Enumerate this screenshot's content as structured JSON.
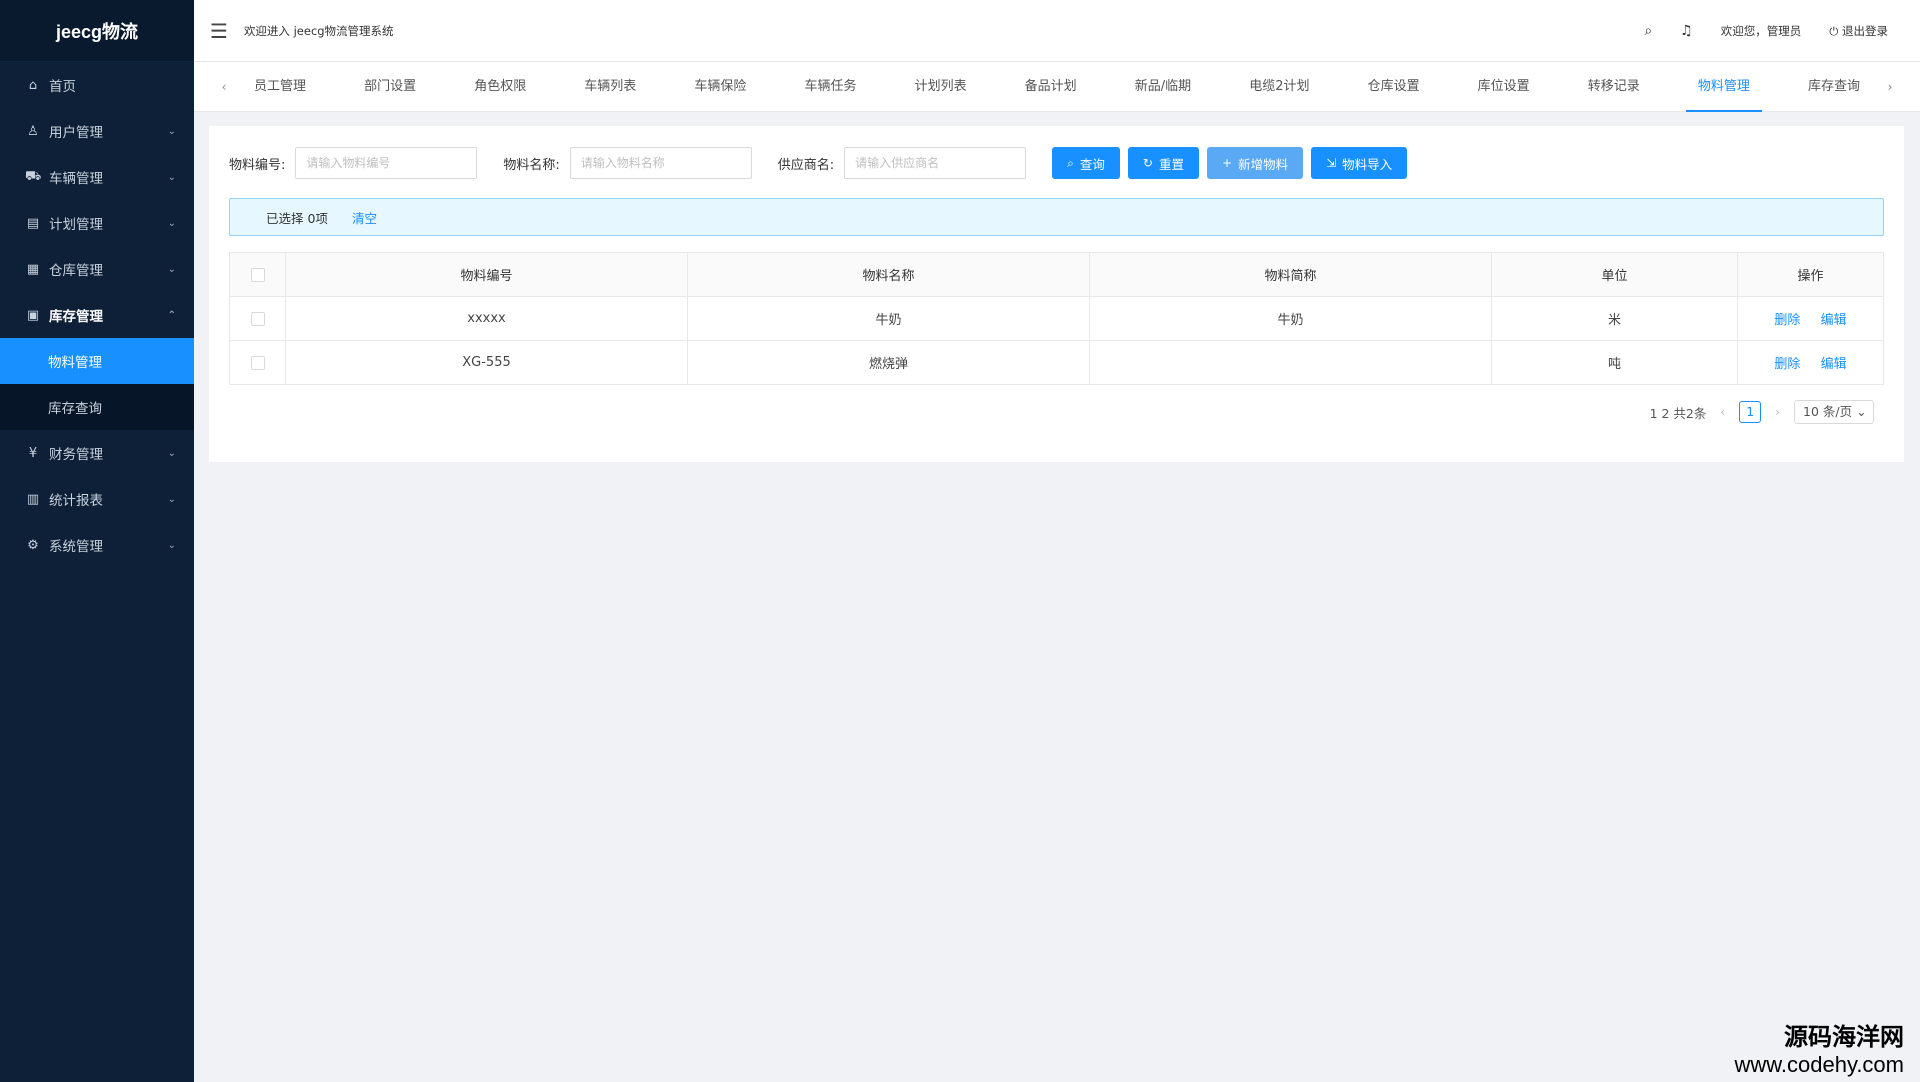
{
  "app": {
    "logo": "jeecg物流",
    "welcome": "欢迎进入 jeecg物流管理系统"
  },
  "header": {
    "greeting": "欢迎您，管理员",
    "logout": "退出登录"
  },
  "sidebar": {
    "items": [
      {
        "label": "首页",
        "icon": "⌂"
      },
      {
        "label": "用户管理",
        "icon": "♙"
      },
      {
        "label": "车辆管理",
        "icon": "⛟"
      },
      {
        "label": "计划管理",
        "icon": "▤"
      },
      {
        "label": "仓库管理",
        "icon": "▦"
      },
      {
        "label": "库存管理",
        "icon": "▣"
      },
      {
        "label": "财务管理",
        "icon": "¥"
      },
      {
        "label": "统计报表",
        "icon": "▥"
      },
      {
        "label": "系统管理",
        "icon": "⚙"
      }
    ],
    "submenu": [
      {
        "label": "物料管理"
      },
      {
        "label": "库存查询"
      }
    ]
  },
  "tabs": [
    "员工管理",
    "部门设置",
    "角色权限",
    "车辆列表",
    "车辆保险",
    "车辆任务",
    "计划列表",
    "备品计划",
    "新品/临期",
    "电缆2计划",
    "仓库设置",
    "库位设置",
    "转移记录",
    "物料管理",
    "库存查询"
  ],
  "search": {
    "code_label": "物料编号:",
    "code_placeholder": "请输入物料编号",
    "name_label": "物料名称:",
    "name_placeholder": "请输入物料名称",
    "supplier_label": "供应商名:",
    "supplier_placeholder": "请输入供应商名"
  },
  "buttons": {
    "query": "查询",
    "reset": "重置",
    "add": "新增物料",
    "import": "物料导入"
  },
  "alert": {
    "selected": "已选择 0项",
    "clear": "清空"
  },
  "table": {
    "headers": [
      "物料编号",
      "物料名称",
      "物料简称",
      "单位",
      "操作"
    ],
    "rows": [
      [
        "xxxxx",
        "牛奶",
        "牛奶",
        "米"
      ],
      [
        "XG-555",
        "燃烧弹",
        "",
        "吨"
      ]
    ],
    "delete": "删除",
    "edit": "编辑"
  },
  "pager": {
    "summary": "1 2 共2条",
    "current": "1",
    "size": "10 条/页"
  },
  "watermark": {
    "line1": "源码海洋网",
    "line2": "www.codehy.com"
  },
  "colors": {
    "sidebar": "#0d2038",
    "primary": "#1890ff"
  }
}
